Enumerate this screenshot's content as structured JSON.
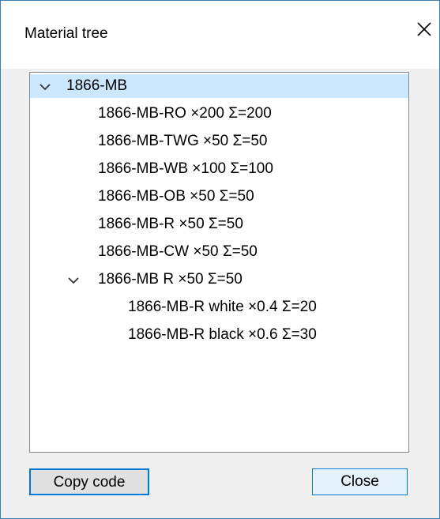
{
  "window": {
    "title": "Material tree"
  },
  "tree": {
    "root": {
      "label": "1866-MB",
      "expanded": true,
      "selected": true
    },
    "children": [
      {
        "label": "1866-MB-RO ×200  Σ=200"
      },
      {
        "label": "1866-MB-TWG ×50  Σ=50"
      },
      {
        "label": "1866-MB-WB ×100  Σ=100"
      },
      {
        "label": "1866-MB-OB ×50  Σ=50"
      },
      {
        "label": "1866-MB-R ×50  Σ=50"
      },
      {
        "label": "1866-MB-CW ×50  Σ=50"
      },
      {
        "label": "1866-MB R ×50  Σ=50",
        "expanded": true,
        "children": [
          {
            "label": "1866-MB-R white ×0.4  Σ=20"
          },
          {
            "label": "1866-MB-R black ×0.6  Σ=30"
          }
        ]
      }
    ]
  },
  "buttons": {
    "copy_label": "Copy code",
    "close_label": "Close"
  },
  "colors": {
    "selection": "#cce8ff",
    "accent": "#0078d7",
    "window_border": "#3c7fb1"
  },
  "icons": {
    "close": "close-icon",
    "expand": "chevron-down-icon"
  }
}
